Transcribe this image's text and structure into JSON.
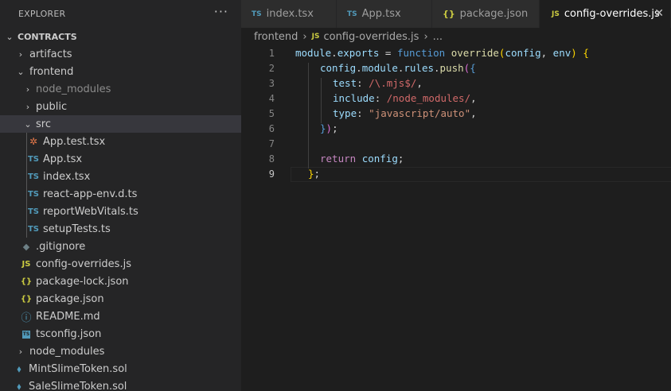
{
  "explorer": {
    "title": "EXPLORER",
    "more": "···",
    "root": "CONTRACTS",
    "items": [
      {
        "label": "artifacts"
      },
      {
        "label": "frontend"
      },
      {
        "label": "node_modules"
      },
      {
        "label": "public"
      },
      {
        "label": "src"
      },
      {
        "label": "App.test.tsx"
      },
      {
        "label": "App.tsx"
      },
      {
        "label": "index.tsx"
      },
      {
        "label": "react-app-env.d.ts"
      },
      {
        "label": "reportWebVitals.ts"
      },
      {
        "label": "setupTests.ts"
      },
      {
        "label": ".gitignore"
      },
      {
        "label": "config-overrides.js"
      },
      {
        "label": "package-lock.json"
      },
      {
        "label": "package.json"
      },
      {
        "label": "README.md"
      },
      {
        "label": "tsconfig.json"
      },
      {
        "label": "node_modules"
      },
      {
        "label": "MintSlimeToken.sol"
      },
      {
        "label": "SaleSlimeToken.sol"
      }
    ]
  },
  "icons": {
    "ts": "TS",
    "js": "JS",
    "json": "{}",
    "chevron_right": "›",
    "chevron_down": "⌄",
    "close": "✕"
  },
  "tabs": [
    {
      "label": "index.tsx",
      "icon": "TS"
    },
    {
      "label": "App.tsx",
      "icon": "TS"
    },
    {
      "label": "package.json",
      "icon": "{}"
    },
    {
      "label": "config-overrides.js",
      "icon": "JS",
      "active": true
    }
  ],
  "breadcrumb": {
    "folder": "frontend",
    "file": "config-overrides.js",
    "more": "..."
  },
  "editor": {
    "line_numbers": [
      "1",
      "2",
      "3",
      "4",
      "5",
      "6",
      "7",
      "8",
      "9"
    ],
    "tokens": {
      "l1": [
        "module",
        ".",
        "exports",
        " = ",
        "function",
        " ",
        "override",
        "(",
        "config",
        ", ",
        "env",
        ") ",
        "{"
      ],
      "l2": [
        "config",
        ".",
        "module",
        ".",
        "rules",
        ".",
        "push",
        "(",
        "{"
      ],
      "l3": [
        "test",
        ": ",
        "/\\.mjs$/",
        ","
      ],
      "l4": [
        "include",
        ": ",
        "/node_modules/",
        ","
      ],
      "l5": [
        "type",
        ": ",
        "\"javascript/auto\"",
        ","
      ],
      "l6": [
        "}",
        ")",
        ";"
      ],
      "l8": [
        "return",
        " ",
        "config",
        ";"
      ],
      "l9": [
        "}",
        ";"
      ]
    }
  }
}
